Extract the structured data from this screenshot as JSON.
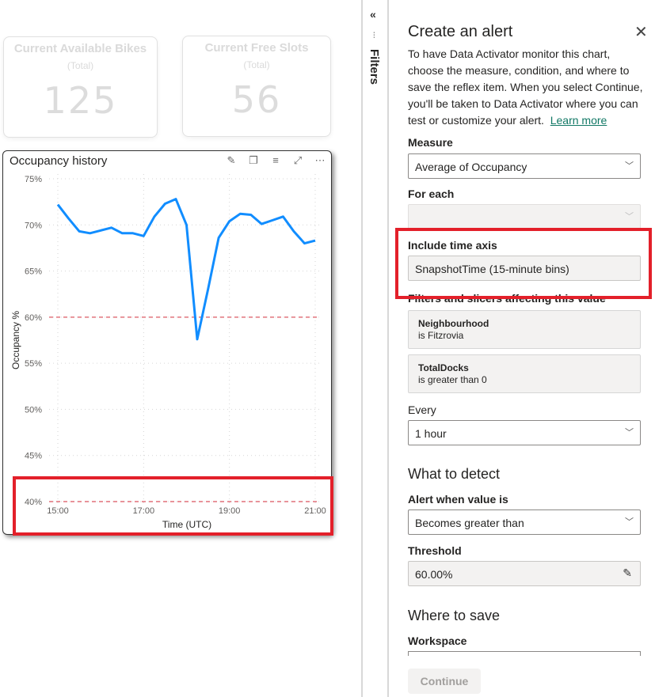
{
  "cards": [
    {
      "title": "Current Available Bikes",
      "subtitle": "(Total)",
      "value": "125"
    },
    {
      "title": "Current Free Slots",
      "subtitle": "(Total)",
      "value": "56"
    }
  ],
  "visual": {
    "title": "Occupancy history",
    "icons": [
      "pin-icon",
      "copy-icon",
      "filter-icon",
      "focus-mode-icon",
      "more-options-icon"
    ]
  },
  "chart_data": {
    "type": "line",
    "title": "Occupancy history",
    "xlabel": "Time (UTC)",
    "ylabel": "Occupancy %",
    "x_ticks": [
      "15:00",
      "17:00",
      "19:00",
      "21:00"
    ],
    "y_ticks": [
      "40%",
      "45%",
      "50%",
      "55%",
      "60%",
      "65%",
      "70%",
      "75%"
    ],
    "ylim": [
      40,
      75
    ],
    "xlim_hours": [
      15,
      21
    ],
    "grid": true,
    "x": [
      "15:00",
      "15:15",
      "15:30",
      "15:45",
      "16:00",
      "16:15",
      "16:30",
      "16:45",
      "17:00",
      "17:15",
      "17:30",
      "17:45",
      "18:00",
      "18:15",
      "18:30",
      "18:45",
      "19:00",
      "19:15",
      "19:30",
      "19:45",
      "20:00",
      "20:15",
      "20:30",
      "20:45",
      "21:00"
    ],
    "series": [
      {
        "name": "Average of Occupancy",
        "color": "#118DFF",
        "values": [
          72.2,
          70.7,
          69.3,
          69.1,
          69.4,
          69.7,
          69.1,
          69.1,
          68.8,
          70.9,
          72.3,
          72.8,
          70.0,
          57.6,
          63.0,
          68.6,
          70.4,
          71.2,
          71.1,
          70.1,
          70.5,
          70.9,
          69.3,
          68.0,
          68.3
        ]
      }
    ],
    "reference_lines": [
      {
        "value": 60,
        "color": "#E8939A",
        "style": "dashed"
      },
      {
        "value": 40,
        "color": "#E8939A",
        "style": "dashed"
      }
    ]
  },
  "filters_pane": {
    "collapse_icon": "«",
    "label": "Filters"
  },
  "alert_panel": {
    "title": "Create an alert",
    "close_icon": "✕",
    "description": "To have Data Activator monitor this chart, choose the measure, condition, and where to save the reflex item. When you select Continue, you'll be taken to Data Activator where you can test or customize your alert.",
    "learn_more": "Learn more",
    "measure_label": "Measure",
    "measure_value": "Average of Occupancy",
    "for_each_label": "For each",
    "for_each_value": "",
    "time_axis_label": "Include time axis",
    "time_axis_value": "SnapshotTime (15-minute bins)",
    "filters_label": "Filters and slicers affecting this value",
    "filters": [
      {
        "name": "Neighbourhood",
        "condition": "is Fitzrovia"
      },
      {
        "name": "TotalDocks",
        "condition": "is greater than 0"
      }
    ],
    "every_label": "Every",
    "every_value": "1 hour",
    "detect_heading": "What to detect",
    "alert_when_label": "Alert when value is",
    "alert_when_value": "Becomes greater than",
    "threshold_label": "Threshold",
    "threshold_value": "60.00%",
    "save_heading": "Where to save",
    "workspace_label": "Workspace",
    "continue_label": "Continue"
  },
  "colors": {
    "line": "#118DFF",
    "reference": "#E8939A",
    "highlight": "#E3202A",
    "link": "#117865"
  }
}
